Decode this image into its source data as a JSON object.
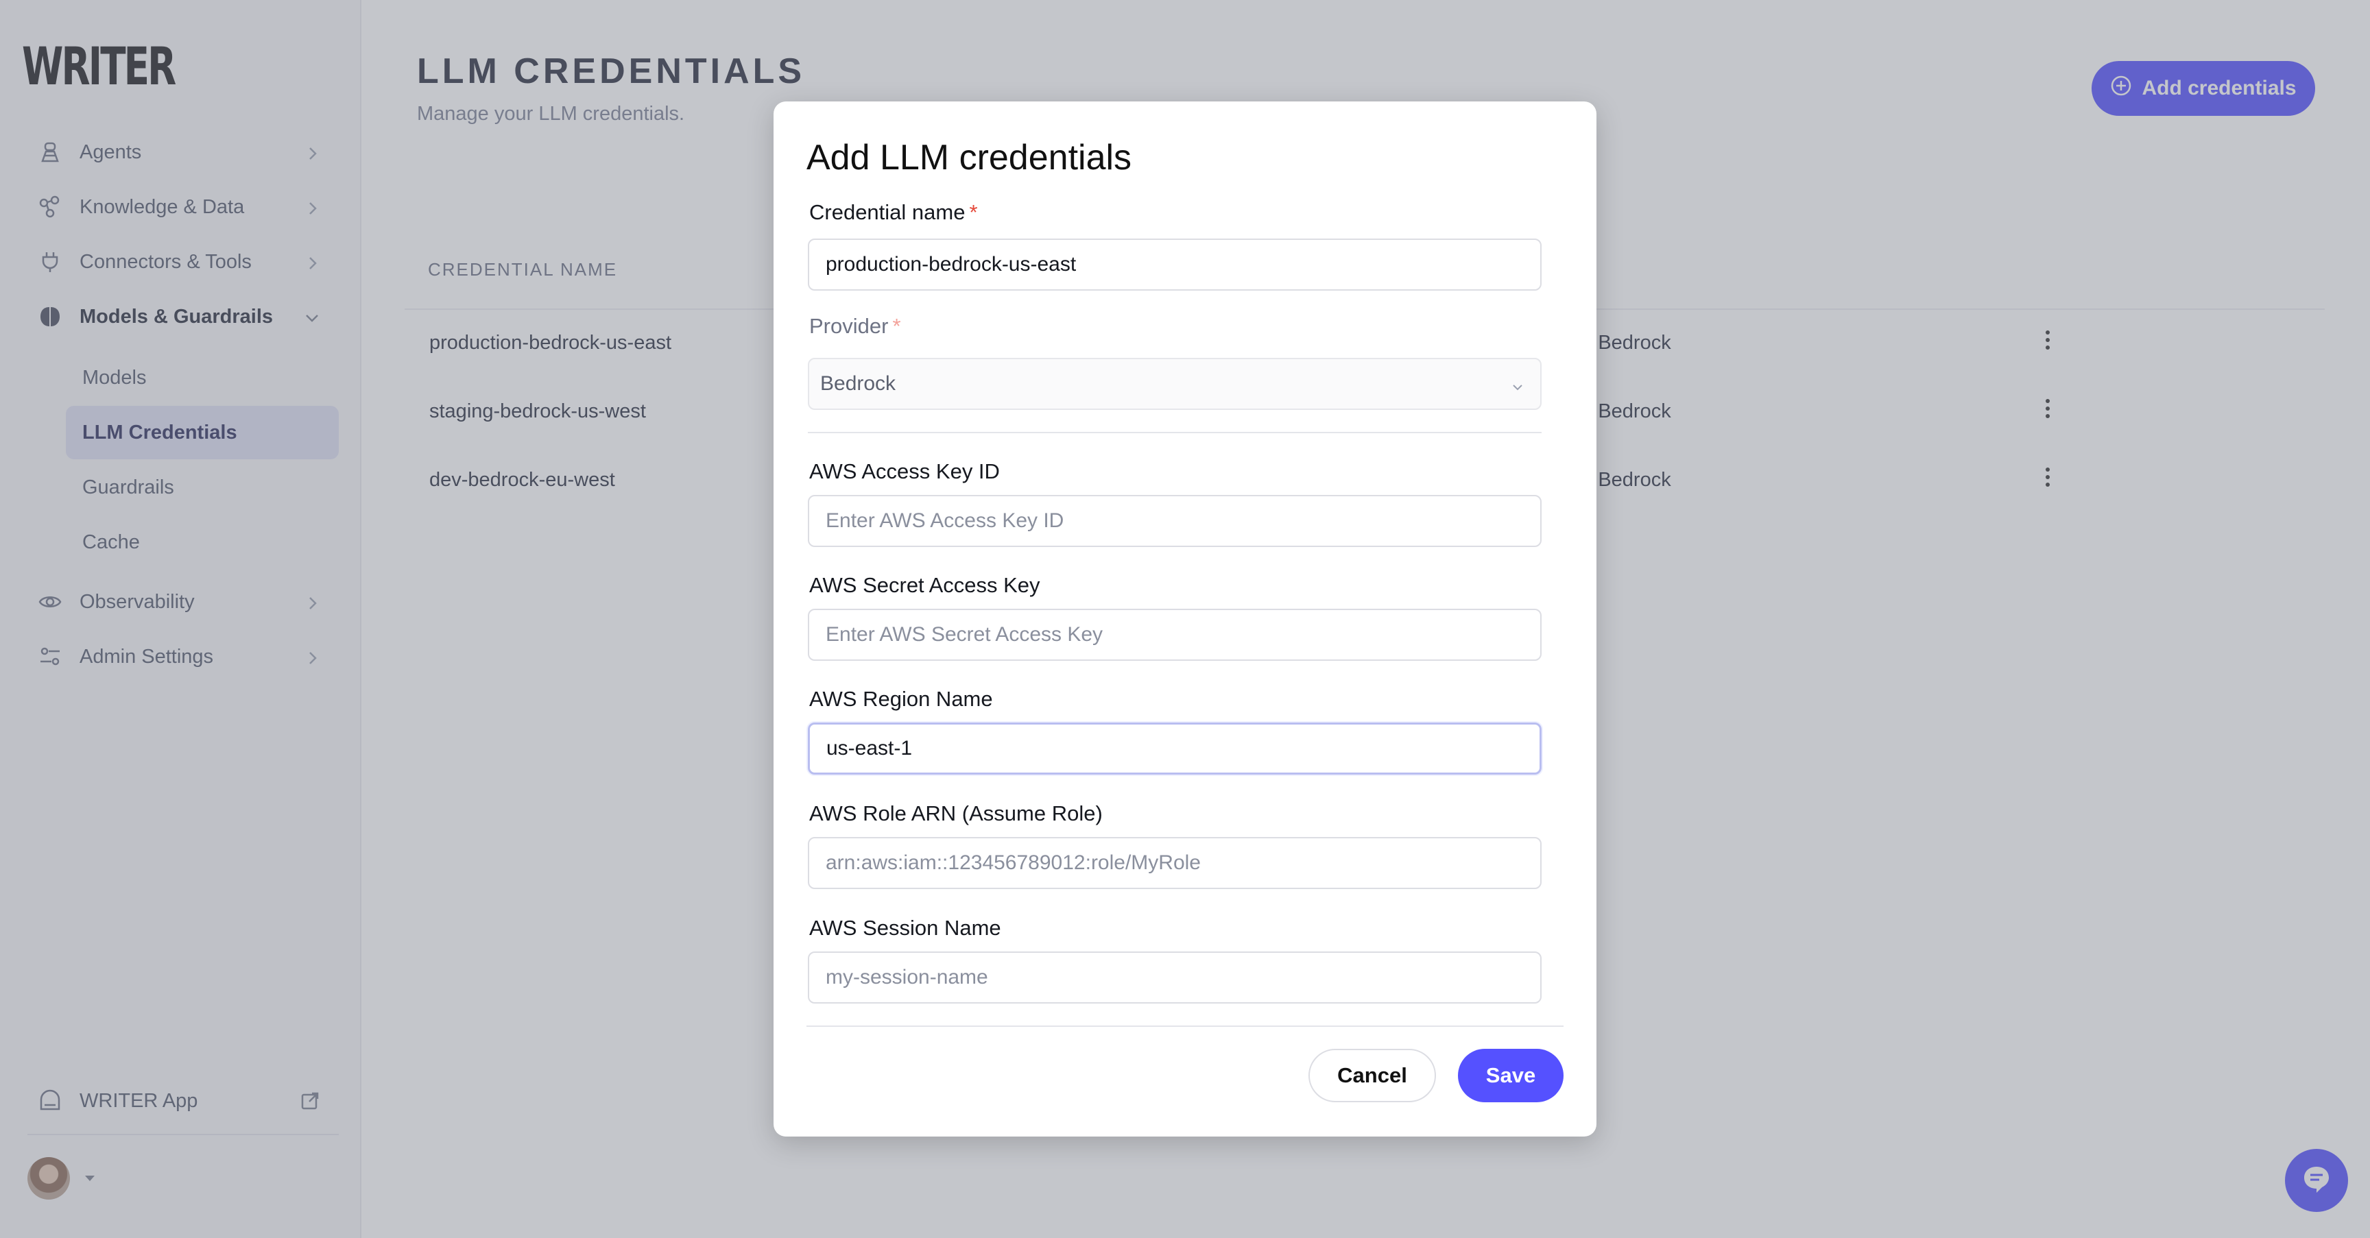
{
  "sidebar": {
    "logo": "WRITER",
    "nav": [
      {
        "label": "Agents"
      },
      {
        "label": "Knowledge & Data"
      },
      {
        "label": "Connectors & Tools"
      },
      {
        "label": "Models & Guardrails"
      },
      {
        "label": "Observability"
      },
      {
        "label": "Admin Settings"
      }
    ],
    "sub_items": [
      {
        "label": "Models"
      },
      {
        "label": "LLM Credentials",
        "active": true
      },
      {
        "label": "Guardrails"
      },
      {
        "label": "Cache"
      }
    ],
    "writer_app": "WRITER App"
  },
  "page": {
    "title": "LLM CREDENTIALS",
    "subtitle": "Manage your LLM credentials.",
    "add_button": "Add credentials"
  },
  "table": {
    "column_header": "CREDENTIAL NAME",
    "rows": [
      {
        "name": "production-bedrock-us-east",
        "provider": "on Bedrock"
      },
      {
        "name": "staging-bedrock-us-west",
        "provider": "on Bedrock"
      },
      {
        "name": "dev-bedrock-eu-west",
        "provider": "on Bedrock"
      }
    ]
  },
  "modal": {
    "title": "Add LLM credentials",
    "fields": {
      "credential_name": {
        "label": "Credential name",
        "required": "*",
        "value": "production-bedrock-us-east"
      },
      "provider": {
        "label": "Provider",
        "required": "*",
        "value": "Bedrock"
      },
      "access_key": {
        "label": "AWS Access Key ID",
        "placeholder": "Enter AWS Access Key ID"
      },
      "secret_key": {
        "label": "AWS Secret Access Key",
        "placeholder": "Enter AWS Secret Access Key"
      },
      "region": {
        "label": "AWS Region Name",
        "value": "us-east-1"
      },
      "role_arn": {
        "label": "AWS Role ARN (Assume Role)",
        "placeholder": "arn:aws:iam::123456789012:role/MyRole"
      },
      "session_name": {
        "label": "AWS Session Name",
        "placeholder": "my-session-name"
      }
    },
    "cancel_label": "Cancel",
    "save_label": "Save"
  },
  "colors": {
    "accent": "#5551ff",
    "required": "#e5493a",
    "active_nav_bg": "#dfe0f3"
  },
  "icons": [
    "agents-icon",
    "knowledge-icon",
    "connectors-icon",
    "models-icon",
    "observability-icon",
    "admin-settings-icon",
    "writer-app-icon",
    "external-link-icon",
    "chevron-right-icon",
    "chevron-down-icon",
    "plus-circle-icon",
    "kebab-menu-icon",
    "chat-help-icon"
  ]
}
